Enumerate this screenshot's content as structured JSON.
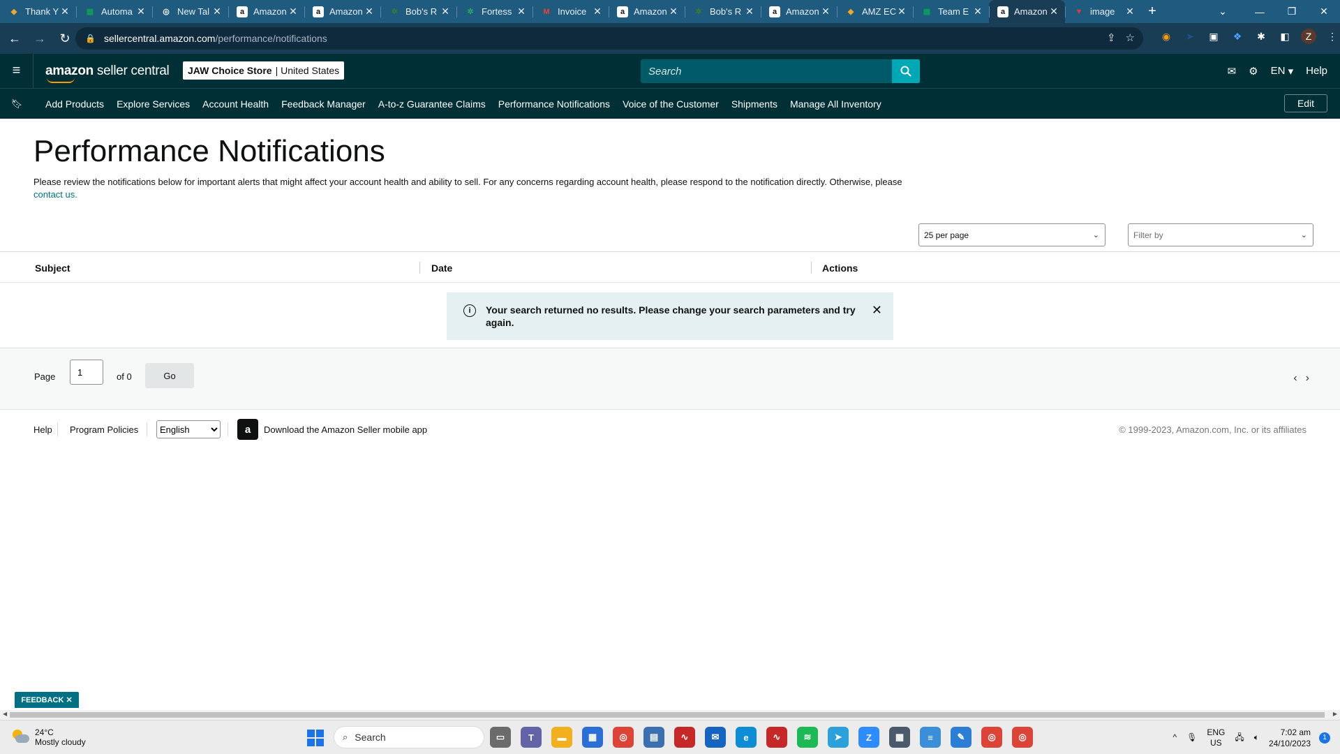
{
  "browser": {
    "tabs": [
      {
        "title": "Thank Y",
        "favicon": "firebase-icon",
        "color": "#f6a623"
      },
      {
        "title": "Automa",
        "favicon": "sheets-icon",
        "color": "#0f9d58"
      },
      {
        "title": "New Tal",
        "favicon": "chrome-icon",
        "color": "#ffffff"
      },
      {
        "title": "Amazon",
        "favicon": "amazon-icon",
        "color": "#111111"
      },
      {
        "title": "Amazon",
        "favicon": "amazon-icon",
        "color": "#111111"
      },
      {
        "title": "Bob's R",
        "favicon": "leaf-icon",
        "color": "#3a7d2c"
      },
      {
        "title": "Fortess",
        "favicon": "leaf-icon",
        "color": "#27ae60"
      },
      {
        "title": "Invoice",
        "favicon": "gmail-icon",
        "color": "#ea4335"
      },
      {
        "title": "Amazon",
        "favicon": "amazon-icon",
        "color": "#111111"
      },
      {
        "title": "Bob's R",
        "favicon": "leaf-icon",
        "color": "#3a7d2c"
      },
      {
        "title": "Amazon",
        "favicon": "amazon-icon",
        "color": "#111111"
      },
      {
        "title": "AMZ EC",
        "favicon": "firebase-icon",
        "color": "#f6a623"
      },
      {
        "title": "Team E",
        "favicon": "sheets-icon",
        "color": "#0f9d58"
      },
      {
        "title": "Amazon",
        "favicon": "amazon-icon",
        "color": "#111111",
        "active": true
      },
      {
        "title": "image",
        "favicon": "image-icon",
        "color": "#e53935"
      }
    ],
    "url_host": "sellercentral.amazon.com",
    "url_path": "/performance/notifications",
    "new_tab_symbol": "+",
    "profile_initial": "Z"
  },
  "header": {
    "logo_bold": "amazon",
    "logo_light": " seller central",
    "store_name": "JAW Choice Store",
    "store_region": "United States",
    "search_placeholder": "Search",
    "language": "EN",
    "help": "Help"
  },
  "nav": {
    "links": [
      "Add Products",
      "Explore Services",
      "Account Health",
      "Feedback Manager",
      "A-to-z Guarantee Claims",
      "Performance Notifications",
      "Voice of the Customer",
      "Shipments",
      "Manage All Inventory"
    ],
    "edit": "Edit"
  },
  "page": {
    "title": "Performance Notifications",
    "description": "Please review the notifications below for important alerts that might affect your account health and ability to sell. For any concerns regarding account health, please respond to the notification directly. Otherwise, please ",
    "contact_link": "contact us.",
    "per_page": "25 per page",
    "filter_placeholder": "Filter by"
  },
  "table": {
    "columns": [
      "Subject",
      "Date",
      "Actions"
    ],
    "empty_message": "Your search returned no results. Please change your search parameters and try again."
  },
  "pager": {
    "page_label": "Page",
    "page_value": "1",
    "of_label": "of 0",
    "go": "Go"
  },
  "footer": {
    "help": "Help",
    "program_policies": "Program Policies",
    "language": "English",
    "app_text": "Download the Amazon Seller mobile app",
    "copyright": "© 1999-2023, Amazon.com, Inc. or its affiliates"
  },
  "feedback": "FEEDBACK",
  "taskbar": {
    "temperature": "24°C",
    "weather": "Mostly cloudy",
    "search": "Search",
    "lang_top": "ENG",
    "lang_bottom": "US",
    "time": "7:02 am",
    "date": "24/10/2023",
    "notifications": "1",
    "apps": [
      {
        "name": "task-view-icon",
        "color": "#6b6b6b"
      },
      {
        "name": "teams-icon",
        "color": "#6264a7"
      },
      {
        "name": "file-explorer-icon",
        "color": "#f2b01e"
      },
      {
        "name": "store-icon",
        "color": "#2b6fd6"
      },
      {
        "name": "chrome-icon",
        "color": "#db4437"
      },
      {
        "name": "remote-desktop-icon",
        "color": "#3a6fb0"
      },
      {
        "name": "chart-app-icon",
        "color": "#c62828"
      },
      {
        "name": "mail-icon",
        "color": "#1565c0"
      },
      {
        "name": "edge-icon",
        "color": "#0c8dd6"
      },
      {
        "name": "chart-app-icon",
        "color": "#c62828"
      },
      {
        "name": "spotify-icon",
        "color": "#1db954"
      },
      {
        "name": "telegram-icon",
        "color": "#2aa1da"
      },
      {
        "name": "zoom-icon",
        "color": "#2d8cff"
      },
      {
        "name": "calculator-icon",
        "color": "#4a5a6a"
      },
      {
        "name": "notepad-icon",
        "color": "#3b8fd8"
      },
      {
        "name": "paint-icon",
        "color": "#2a7fd4"
      },
      {
        "name": "chrome-icon",
        "color": "#db4437"
      },
      {
        "name": "chrome-icon",
        "color": "#db4437"
      }
    ]
  }
}
